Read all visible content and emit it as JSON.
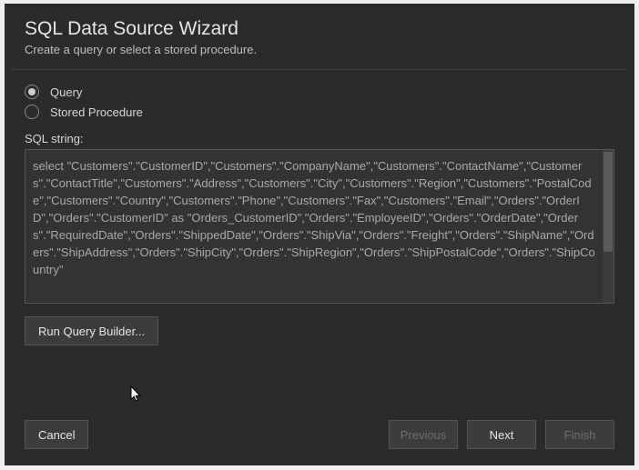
{
  "head": {
    "title": "SQL Data Source Wizard",
    "subtitle": "Create a query or select a stored procedure."
  },
  "options": {
    "query": "Query",
    "stored_procedure": "Stored Procedure"
  },
  "sql": {
    "label": "SQL string:",
    "text": "select \"Customers\".\"CustomerID\",\"Customers\".\"CompanyName\",\"Customers\".\"ContactName\",\"Customers\".\"ContactTitle\",\"Customers\".\"Address\",\"Customers\".\"City\",\"Customers\".\"Region\",\"Customers\".\"PostalCode\",\"Customers\".\"Country\",\"Customers\".\"Phone\",\"Customers\".\"Fax\",\"Customers\".\"Email\",\"Orders\".\"OrderID\",\"Orders\".\"CustomerID\" as \"Orders_CustomerID\",\"Orders\".\"EmployeeID\",\"Orders\".\"OrderDate\",\"Orders\".\"RequiredDate\",\"Orders\".\"ShippedDate\",\"Orders\".\"ShipVia\",\"Orders\".\"Freight\",\"Orders\".\"ShipName\",\"Orders\".\"ShipAddress\",\"Orders\".\"ShipCity\",\"Orders\".\"ShipRegion\",\"Orders\".\"ShipPostalCode\",\"Orders\".\"ShipCountry\""
  },
  "buttons": {
    "run_query_builder": "Run Query Builder...",
    "cancel": "Cancel",
    "previous": "Previous",
    "next": "Next",
    "finish": "Finish"
  }
}
